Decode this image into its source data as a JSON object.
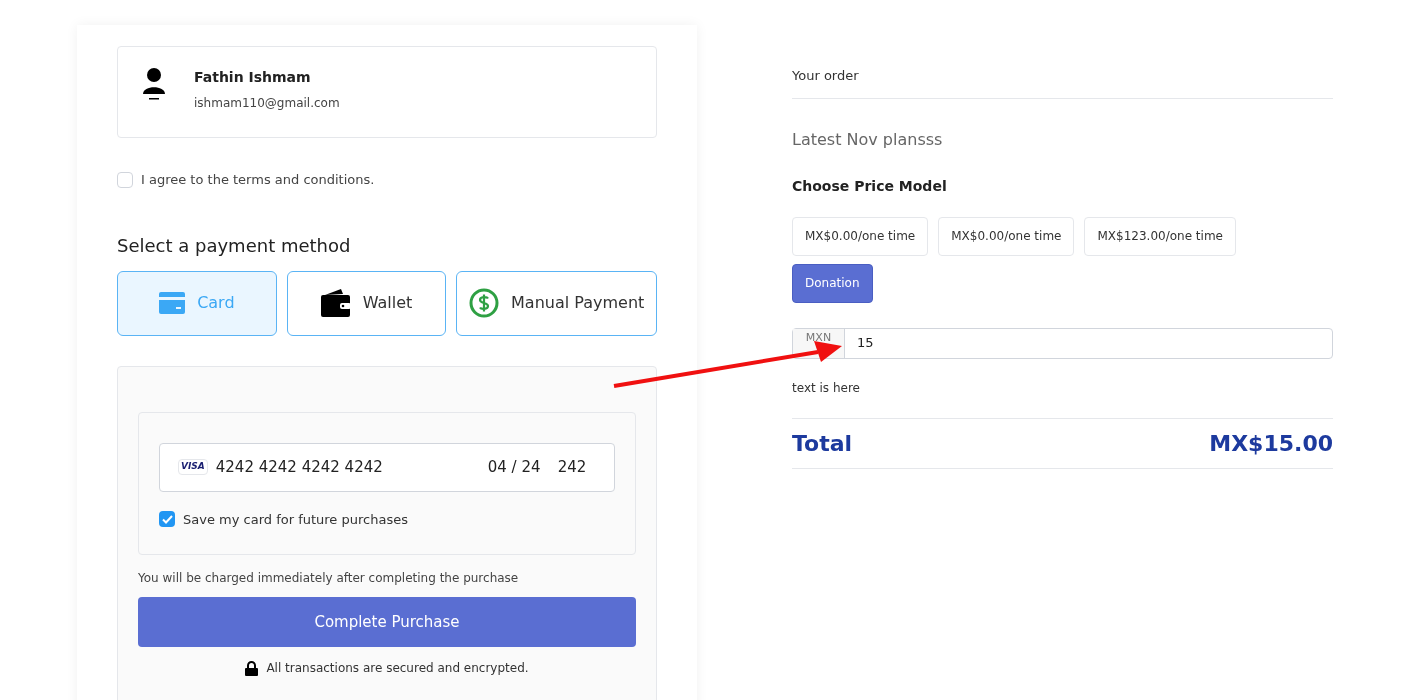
{
  "user": {
    "name": "Fathin Ishmam",
    "email": "ishmam110@gmail.com"
  },
  "terms": {
    "label": "I agree to the terms and conditions.",
    "checked": false
  },
  "payment_heading": "Select a payment method",
  "methods": [
    {
      "kind": "card",
      "label": "Card",
      "selected": true
    },
    {
      "kind": "wallet",
      "label": "Wallet",
      "selected": false
    },
    {
      "kind": "manual",
      "label": "Manual Payment",
      "selected": false
    }
  ],
  "card_form": {
    "brand": "VISA",
    "number": "4242 4242 4242 4242",
    "expiry": "04 / 24",
    "cvc": "242",
    "save": {
      "label": "Save my card for future purchases",
      "checked": true
    }
  },
  "charge_note": "You will be charged immediately after completing the purchase",
  "purchase_button": "Complete Purchase",
  "secure_note": "All transactions are secured and encrypted.",
  "order": {
    "title": "Your order",
    "plan": "Latest Nov plansss",
    "price_heading": "Choose Price Model",
    "prices": [
      {
        "label": "MX$0.00/one time",
        "selected": false
      },
      {
        "label": "MX$0.00/one time",
        "selected": false
      },
      {
        "label": "MX$123.00/one time",
        "selected": false
      },
      {
        "label": "Donation",
        "selected": true
      }
    ],
    "currency": "MXN",
    "amount": "15",
    "note": "text is here",
    "total_label": "Total",
    "total": "MX$15.00"
  }
}
